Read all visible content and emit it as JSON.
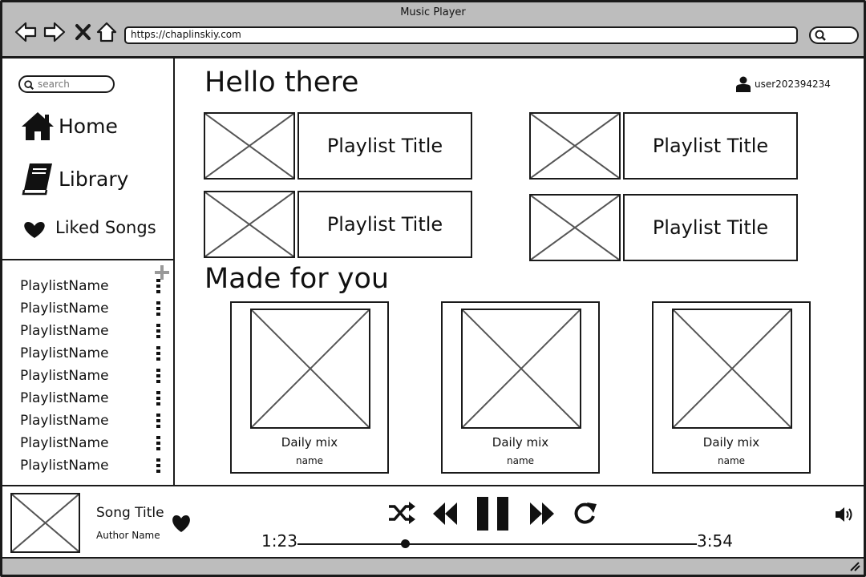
{
  "window": {
    "title": "Music Player"
  },
  "browser": {
    "url": "https://chaplinskiy.com",
    "nav_icons": [
      "back-arrow-icon",
      "forward-arrow-icon",
      "close-icon",
      "home-icon"
    ],
    "search_icon": "search-icon"
  },
  "sidebar": {
    "search_placeholder": "search",
    "nav": [
      {
        "label": "Home",
        "icon": "home-icon"
      },
      {
        "label": "Library",
        "icon": "book-icon"
      },
      {
        "label": "Liked Songs",
        "icon": "heart-icon"
      }
    ],
    "add_icon": "plus-icon",
    "playlists": [
      "PlaylistName",
      "PlaylistName",
      "PlaylistName",
      "PlaylistName",
      "PlaylistName",
      "PlaylistName",
      "PlaylistName",
      "PlaylistName",
      "PlaylistName"
    ]
  },
  "main": {
    "greeting": "Hello there",
    "username": "user202394234",
    "playlist_cards": [
      {
        "title": "Playlist Title"
      },
      {
        "title": "Playlist Title"
      },
      {
        "title": "Playlist Title"
      },
      {
        "title": "Playlist Title"
      }
    ],
    "made_for_you_heading": "Made for you",
    "mixes": [
      {
        "title": "Daily mix",
        "subtitle": "name"
      },
      {
        "title": "Daily mix",
        "subtitle": "name"
      },
      {
        "title": "Daily mix",
        "subtitle": "name"
      }
    ]
  },
  "player": {
    "song_title": "Song Title",
    "author": "Author Name",
    "current_time": "1:23",
    "total_time": "3:54",
    "progress_fraction": 0.27,
    "controls": [
      "shuffle-icon",
      "rewind-icon",
      "pause-icon",
      "fast-forward-icon",
      "repeat-icon"
    ],
    "volume_icon": "volume-icon"
  }
}
